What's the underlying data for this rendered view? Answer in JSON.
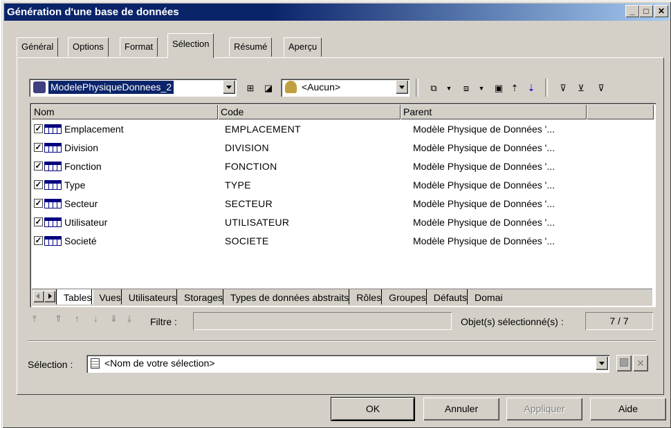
{
  "window": {
    "title": "Génération d'une base de données",
    "controls": [
      "_",
      "□",
      "✕"
    ]
  },
  "tabs": [
    {
      "label": "Général"
    },
    {
      "label": "Options"
    },
    {
      "label": "Format"
    },
    {
      "label": "Sélection",
      "active": true
    },
    {
      "label": "Résumé"
    },
    {
      "label": "Aperçu"
    }
  ],
  "toolbar": {
    "model_combo": "ModelePhysiqueDonnees_2",
    "owner_combo": "<Aucun>",
    "icons": [
      "model-icon",
      "hierarchy-icon",
      "restore-icon",
      "user-icon",
      "select-all-icon",
      "deselect-all-icon",
      "select-icon",
      "move-up-icon",
      "move-down-icon",
      "filter-icon",
      "filter-clear-icon",
      "filter-apply-icon"
    ]
  },
  "list": {
    "columns": [
      "Nom",
      "Code",
      "Parent"
    ],
    "rows": [
      {
        "name": "Emplacement",
        "code": "EMPLACEMENT",
        "parent": "Modèle Physique de Données '...",
        "checked": true
      },
      {
        "name": "Division",
        "code": "DIVISION",
        "parent": "Modèle Physique de Données '...",
        "checked": true
      },
      {
        "name": "Fonction",
        "code": "FONCTION",
        "parent": "Modèle Physique de Données '...",
        "checked": true
      },
      {
        "name": "Type",
        "code": "TYPE",
        "parent": "Modèle Physique de Données '...",
        "checked": true
      },
      {
        "name": "Secteur",
        "code": "SECTEUR",
        "parent": "Modèle Physique de Données '...",
        "checked": true
      },
      {
        "name": "Utilisateur",
        "code": "UTILISATEUR",
        "parent": "Modèle Physique de Données '...",
        "checked": true
      },
      {
        "name": "Societé",
        "code": "SOCIETE",
        "parent": "Modèle Physique de Données '...",
        "checked": true
      }
    ],
    "subtabs": [
      "Tables",
      "Vues",
      "Utilisateurs",
      "Storages",
      "Types de données abstraits",
      "Rôles",
      "Groupes",
      "Défauts",
      "Domai"
    ]
  },
  "filter": {
    "label": "Filtre :",
    "value": "",
    "selected_label": "Objet(s) sélectionné(s) :",
    "selected_count": "7 / 7"
  },
  "selection": {
    "label": "Sélection :",
    "value": "<Nom de votre sélection>"
  },
  "buttons": {
    "ok": "OK",
    "cancel": "Annuler",
    "apply": "Appliquer",
    "help": "Aide"
  },
  "colors": {
    "title_start": "#0a246a",
    "title_end": "#a6caf0",
    "face": "#d4d0c8",
    "selection_highlight": "#0a246a"
  }
}
